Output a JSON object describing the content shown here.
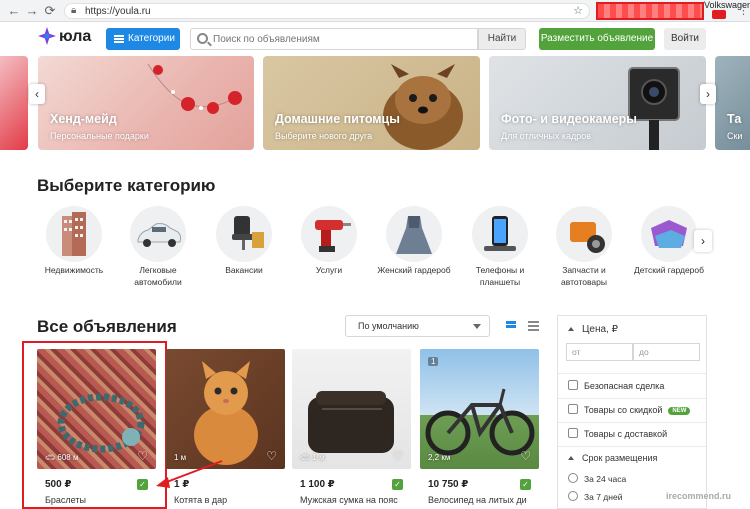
{
  "browser": {
    "url": "https://youla.ru",
    "profile_name": "Volkswagen"
  },
  "header": {
    "logo": "юла",
    "categories_label": "Категории",
    "search_placeholder": "Поиск по объявлениям",
    "find_label": "Найти",
    "post_ad_label": "Разместить объявление",
    "login_label": "Войти",
    "colors": {
      "primary": "#1e88e5",
      "post": "#52a33c",
      "selection": "#e01b22"
    }
  },
  "banners": [
    {
      "title": "",
      "subtitle": ""
    },
    {
      "title": "Хенд-мейд",
      "subtitle": "Персональные подарки"
    },
    {
      "title": "Домашние питомцы",
      "subtitle": "Выберите нового друга"
    },
    {
      "title": "Фото- и видеокамеры",
      "subtitle": "Для отличных кадров"
    },
    {
      "title": "Та",
      "subtitle": "Ски"
    }
  ],
  "category_section": {
    "title": "Выберите категорию",
    "items": [
      {
        "label": "Недвижимость",
        "icon": "building-icon"
      },
      {
        "label": "Легковые автомобили",
        "icon": "car-icon"
      },
      {
        "label": "Вакансии",
        "icon": "office-chair-icon"
      },
      {
        "label": "Услуги",
        "icon": "drill-icon"
      },
      {
        "label": "Женский гардероб",
        "icon": "dress-icon"
      },
      {
        "label": "Телефоны и планшеты",
        "icon": "phone-icon"
      },
      {
        "label": "Запчасти и автотовары",
        "icon": "engine-icon"
      },
      {
        "label": "Детский гардероб",
        "icon": "kids-clothes-icon"
      }
    ]
  },
  "listings": {
    "title": "Все объявления",
    "sort_value": "По умолчанию",
    "cards": [
      {
        "price": "500 ₽",
        "name": "Браслеты",
        "distance": "608 м",
        "badge": "",
        "verified": true
      },
      {
        "price": "1 ₽",
        "name": "Котята в дар",
        "distance": "1 м",
        "badge": "",
        "verified": false
      },
      {
        "price": "1 100 ₽",
        "name": "Мужская сумка на пояс",
        "distance": "1 м",
        "badge": "",
        "verified": true
      },
      {
        "price": "10 750 ₽",
        "name": "Велосипед на литых ди",
        "distance": "2,2 км",
        "badge": "1",
        "verified": true
      }
    ]
  },
  "filters": {
    "price_label": "Цена, ₽",
    "from_placeholder": "от",
    "to_placeholder": "до",
    "safe_deal": "Безопасная сделка",
    "discount": "Товары со скидкой",
    "new_badge": "NEW",
    "delivery": "Товары с доставкой",
    "period_label": "Срок размещения",
    "period_options": [
      "За 24 часа",
      "За 7 дней"
    ]
  },
  "watermark": "irecommend.ru"
}
